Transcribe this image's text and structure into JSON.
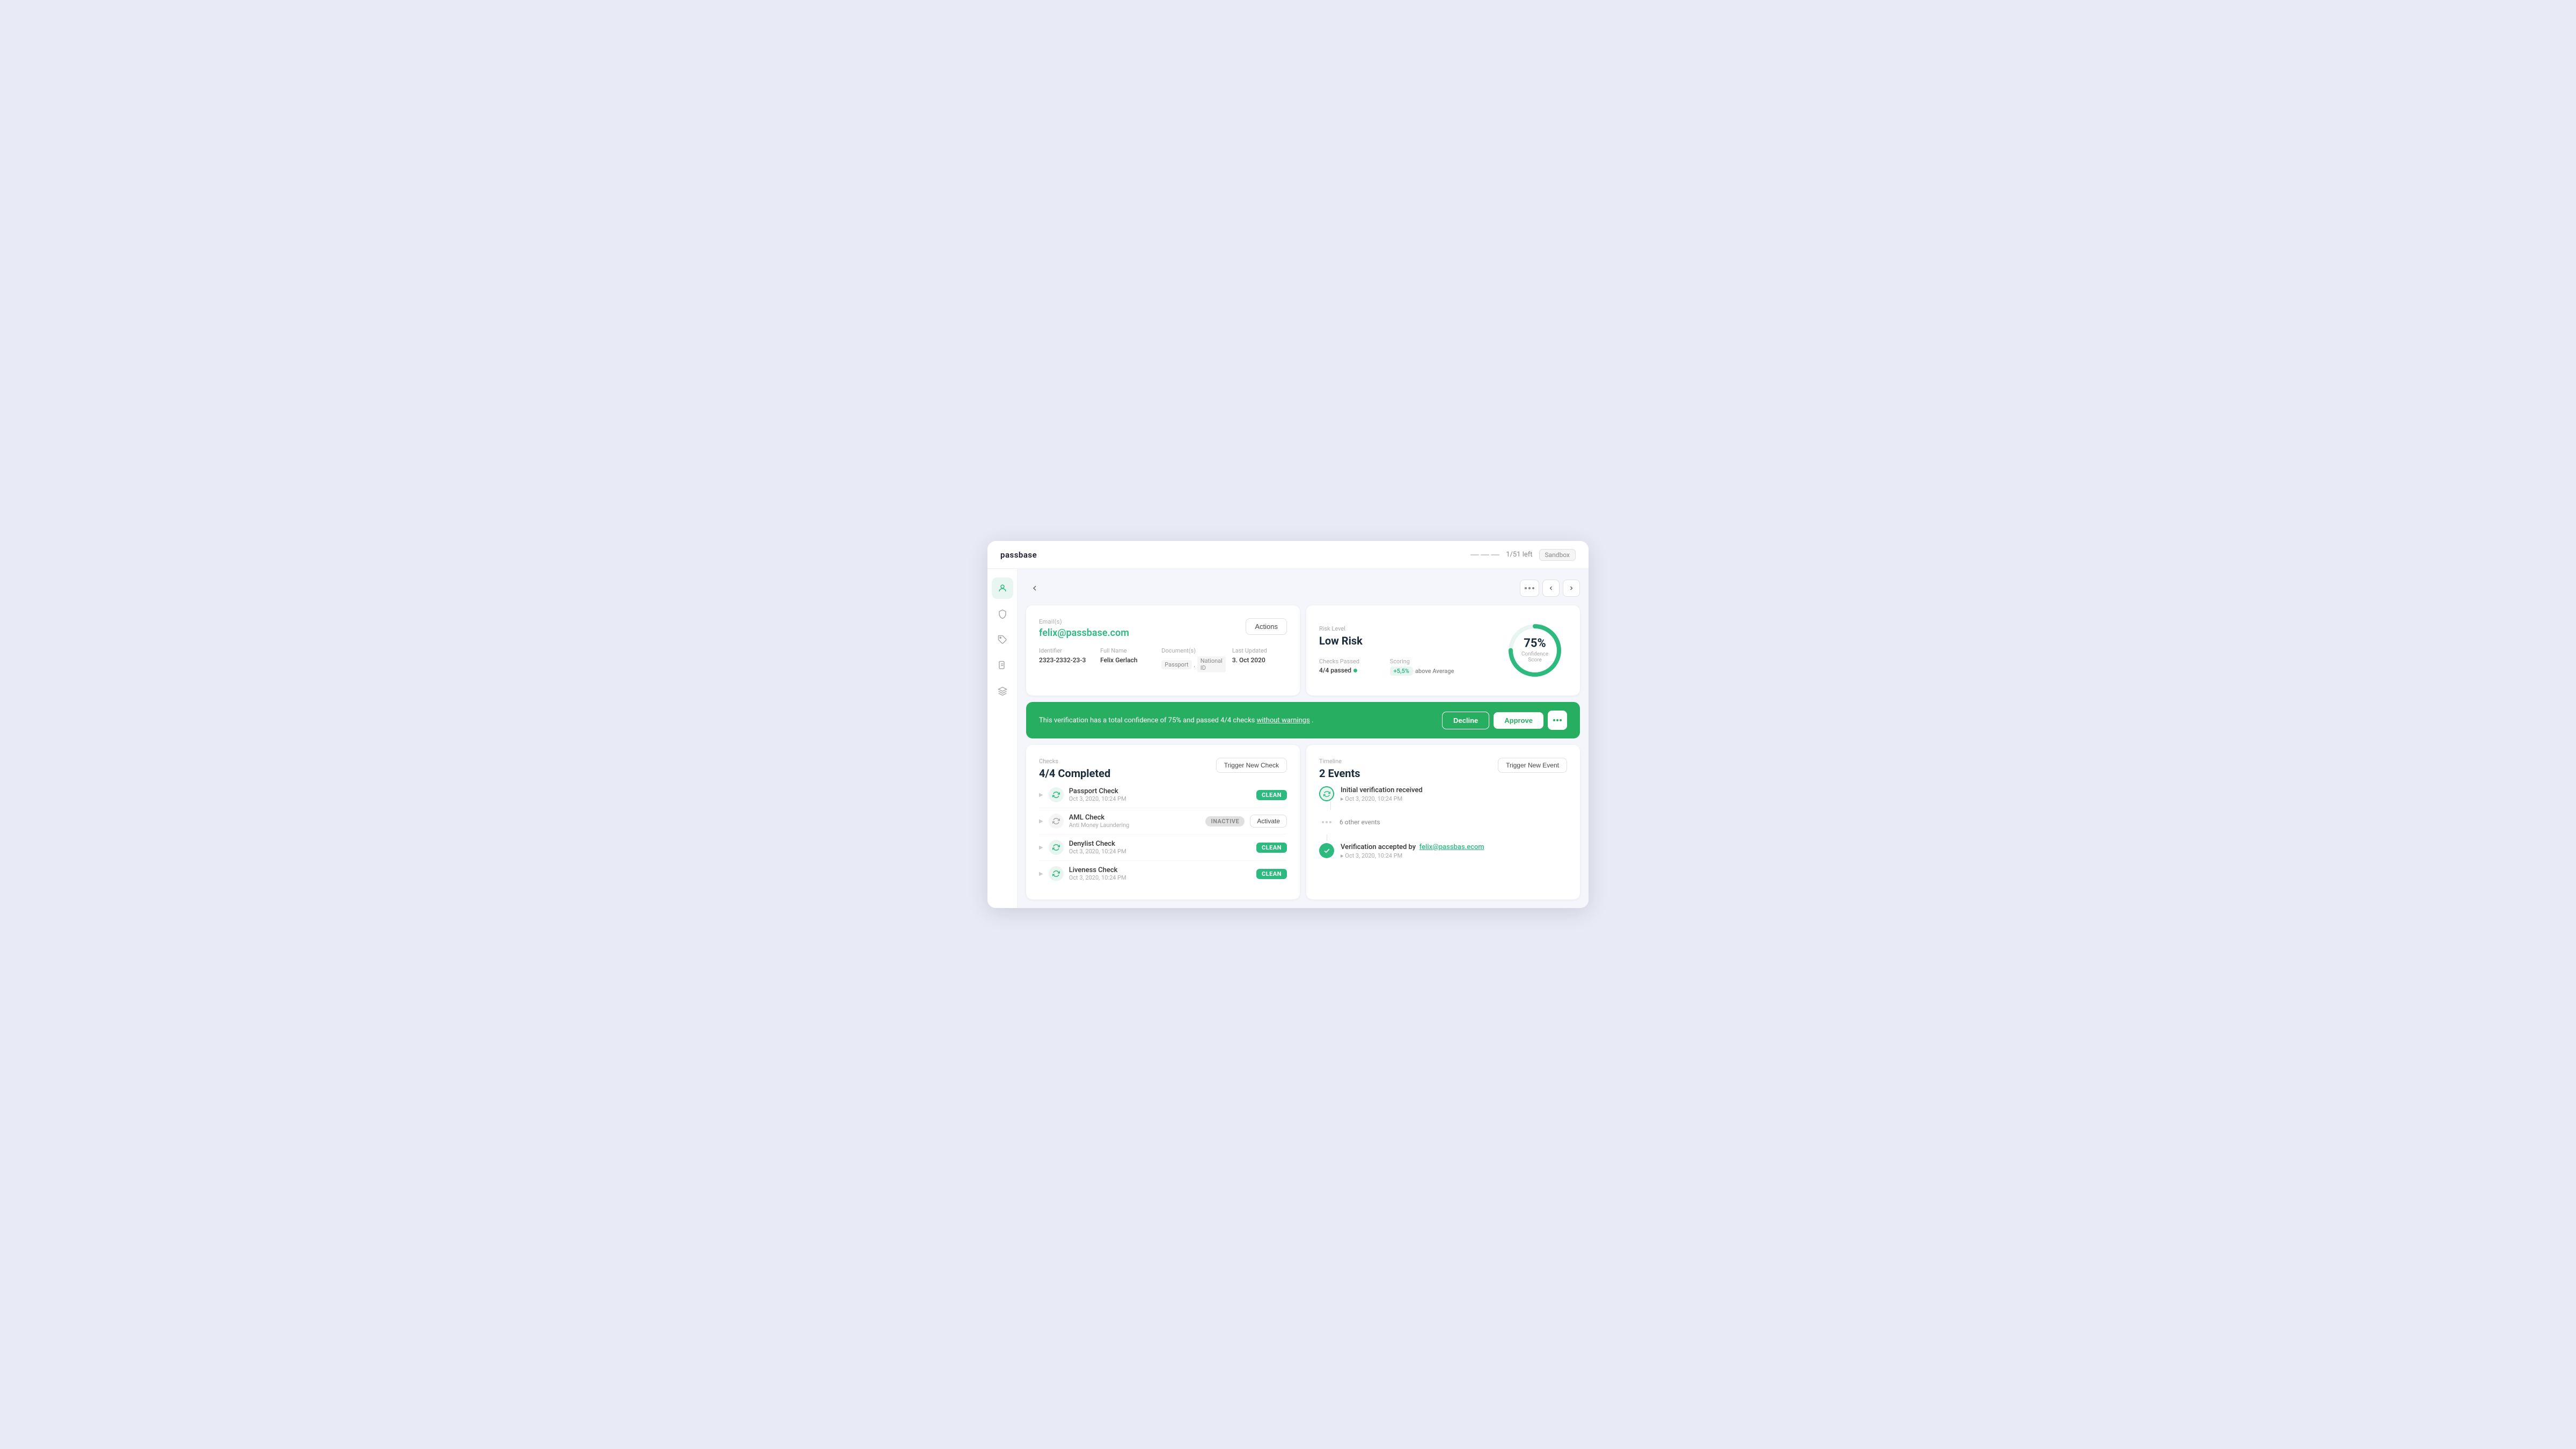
{
  "app": {
    "logo": "passbase",
    "counter": "1/51 left",
    "sandbox_label": "Sandbox"
  },
  "sidebar": {
    "items": [
      {
        "id": "identity",
        "icon": "👤",
        "active": true
      },
      {
        "id": "shield",
        "icon": "🛡️",
        "active": false
      },
      {
        "id": "tag",
        "icon": "🏷️",
        "active": false
      },
      {
        "id": "document",
        "icon": "📄",
        "active": false
      },
      {
        "id": "layers",
        "icon": "⚙️",
        "active": false
      }
    ]
  },
  "identity_card": {
    "email_label": "Email(s)",
    "email_value": "felix@passbase.com",
    "actions_label": "Actions",
    "identifier_label": "Identifier",
    "identifier_value": "2323-2332-23-3",
    "fullname_label": "Full Name",
    "fullname_value": "Felix Gerlach",
    "documents_label": "Document(s)",
    "documents": [
      "Passport",
      "National ID"
    ],
    "last_updated_label": "Last Updated",
    "last_updated_value": "3. Oct 2020"
  },
  "risk_card": {
    "risk_level_label": "Risk Level",
    "risk_level_value": "Low Risk",
    "checks_passed_label": "Checks Passed",
    "checks_passed_value": "4/4 passed",
    "scoring_label": "Scoring",
    "scoring_badge": "+5,5%",
    "scoring_text": "above Average",
    "confidence_percent": "75%",
    "confidence_label": "Confidence Score",
    "circle_radius": 45,
    "circle_circumference": 282.74,
    "circle_progress_value": 212
  },
  "confidence_banner": {
    "text_part1": "This verification has a total confidence of 75% and passed 4/4 checks",
    "text_link": "without warnings",
    "text_part2": ".",
    "decline_label": "Decline",
    "approve_label": "Approve"
  },
  "checks_card": {
    "section_label": "Checks",
    "completed_label": "4/4 Completed",
    "trigger_btn_label": "Trigger New Check",
    "items": [
      {
        "name": "Passport Check",
        "date": "Oct 3, 2020, 10:24 PM",
        "status": "CLEAN",
        "active": true
      },
      {
        "name": "AML Check",
        "sub": "Anti Money Laundering",
        "status": "INACTIVE",
        "active": false,
        "activate_label": "Activate"
      },
      {
        "name": "Denylist Check",
        "date": "Oct 3, 2020, 10:24 PM",
        "status": "CLEAN",
        "active": true
      },
      {
        "name": "Liveness Check",
        "date": "Oct 3, 2020, 10:24 PM",
        "status": "CLEAN",
        "active": true
      }
    ]
  },
  "timeline_card": {
    "section_label": "Timeline",
    "events_count": "2 Events",
    "trigger_btn_label": "Trigger New Event",
    "items": [
      {
        "type": "teal",
        "title": "Initial verification received",
        "date": "Oct 3, 2020, 10:24 PM"
      },
      {
        "type": "other",
        "text": "6 other events"
      },
      {
        "type": "green",
        "title": "Verification accepted by",
        "actor": "felix@passbas.ecom",
        "date": "Oct 3, 2020, 10:24 PM"
      }
    ]
  }
}
